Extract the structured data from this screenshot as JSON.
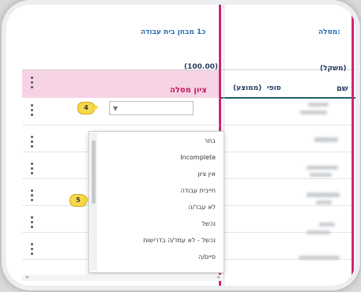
{
  "header": {
    "col_track_label": "מסלה:",
    "col_total_label": "כ1 מבחן בית עבודה",
    "col_total_value": "(100.00)",
    "col_weight_label": "(משקל)",
    "col_name": "שם",
    "col_final": "סופי",
    "col_avg": "(ממוצע)",
    "col_track_grade": "ציון מסלה"
  },
  "badges": {
    "b4": "4",
    "b5": "5"
  },
  "dropdown": {
    "items": [
      "בחר",
      "Incomplete",
      "אין ציון",
      "חייבית עבודה",
      "לא עבר/ה",
      "נכשל",
      "נכשל - לא עמד/ה בדרישות",
      "סיים/ה"
    ]
  },
  "icons": {
    "kebab": "more-vertical-icon",
    "caret": "dropdown-caret-icon"
  }
}
